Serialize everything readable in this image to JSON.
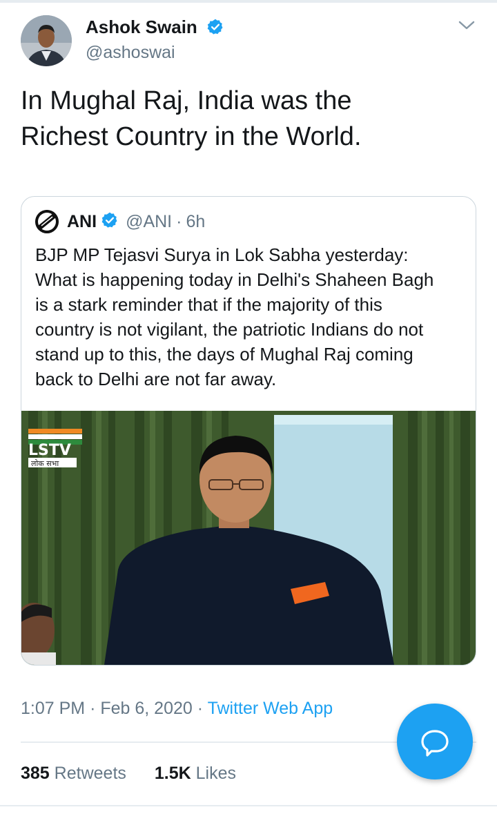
{
  "author": {
    "name": "Ashok Swain",
    "handle": "@ashoswai",
    "verified": true
  },
  "tweet": {
    "text_line1": "In Mughal Raj, India was the",
    "text_line2": "Richest Country in the World."
  },
  "quoted": {
    "name": "ANI",
    "handle": "@ANI",
    "separator": "·",
    "time": "6h",
    "lines": [
      "BJP MP Tejasvi Surya in Lok Sabha yesterday:",
      "What is happening today in Delhi's Shaheen Bagh",
      "is a stark reminder that if the majority of this",
      "country is not vigilant, the patriotic Indians do not",
      "stand up to this, the days of Mughal Raj coming",
      "back to Delhi are not far away."
    ],
    "media": {
      "channel_logo": "LSTV",
      "channel_sub": "लोक सभा"
    }
  },
  "meta": {
    "time": "1:07 PM",
    "sep1": "·",
    "date": "Feb 6, 2020",
    "sep2": "·",
    "source": "Twitter Web App"
  },
  "stats": {
    "retweets_count": "385",
    "retweets_label": "Retweets",
    "likes_count": "1.5K",
    "likes_label": "Likes"
  },
  "colors": {
    "accent": "#1da1f2",
    "secondary_text": "#657786",
    "border": "#ccd6dd"
  },
  "icons": {
    "verified": "verified-badge-icon",
    "menu": "chevron-down-icon",
    "compose": "reply-bubble-icon"
  }
}
